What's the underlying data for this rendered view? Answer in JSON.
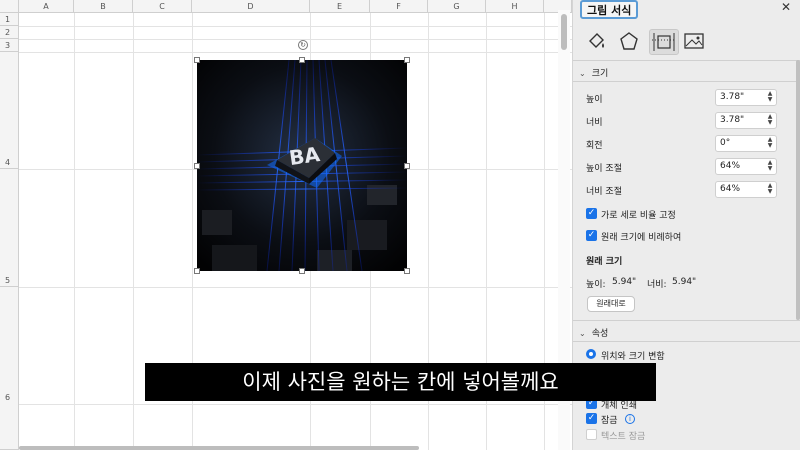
{
  "sheet": {
    "columns": [
      "A",
      "B",
      "C",
      "D",
      "E",
      "F",
      "G",
      "H"
    ],
    "rows": [
      "1",
      "2",
      "3",
      "4",
      "5",
      "6"
    ]
  },
  "picture": {
    "chip_text": "BA"
  },
  "pane": {
    "title": "그림 서식",
    "close_icon": "✕",
    "tabs": [
      "fill-effects-icon",
      "shape-icon",
      "size-properties-icon",
      "picture-icon"
    ],
    "size_section": {
      "header": "크기",
      "height_label": "높이",
      "height_value": "3.78\"",
      "width_label": "너비",
      "width_value": "3.78\"",
      "rotation_label": "회전",
      "rotation_value": "0°",
      "scale_height_label": "높이 조절",
      "scale_height_value": "64%",
      "scale_width_label": "너비 조절",
      "scale_width_value": "64%",
      "lock_aspect_label": "가로 세로 비율 고정",
      "relative_original_label": "원래 크기에 비례하여",
      "original_size_heading": "원래 크기",
      "original_height_label": "높이:",
      "original_height_value": "5.94\"",
      "original_width_label": "너비:",
      "original_width_value": "5.94\"",
      "reset_button": "원래대로"
    },
    "properties_section": {
      "header": "속성",
      "move_size_label": "위치와 크기 변함",
      "print_object_label": "개체 인쇄",
      "locked_label": "잠금",
      "lock_text_label": "텍스트 잠금"
    }
  },
  "caption": "이제 사진을 원하는 칸에 넣어볼께요"
}
